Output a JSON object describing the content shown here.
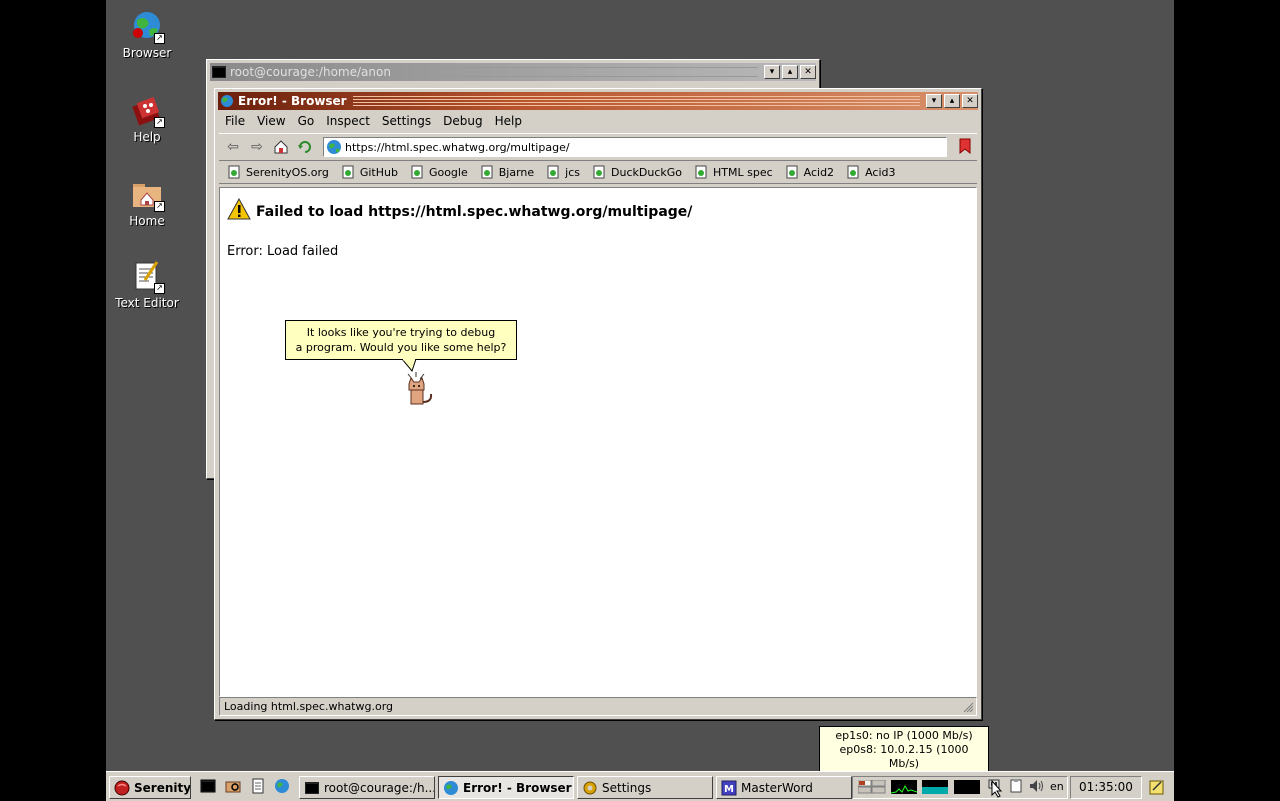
{
  "desktop": {
    "icons": [
      {
        "label": "Browser",
        "icon": "browser-globe-icon"
      },
      {
        "label": "Help",
        "icon": "help-book-icon"
      },
      {
        "label": "Home",
        "icon": "home-folder-icon"
      },
      {
        "label": "Text Editor",
        "icon": "text-editor-icon"
      }
    ]
  },
  "terminal_window": {
    "title": "root@courage:/home/anon"
  },
  "browser_window": {
    "title": "Error! - Browser",
    "menu": [
      "File",
      "View",
      "Go",
      "Inspect",
      "Settings",
      "Debug",
      "Help"
    ],
    "url": "https://html.spec.whatwg.org/multipage/",
    "bookmarks": [
      "SerenityOS.org",
      "GitHub",
      "Google",
      "Bjarne",
      "jcs",
      "DuckDuckGo",
      "HTML spec",
      "Acid2",
      "Acid3"
    ],
    "page": {
      "heading": "Failed to load https://html.spec.whatwg.org/multipage/",
      "error": "Error: Load failed"
    },
    "status": "Loading html.spec.whatwg.org"
  },
  "assistant": {
    "line1": "It looks like you're trying to debug",
    "line2": "a program. Would you like some help?"
  },
  "network_tooltip": {
    "line1": "ep1s0: no IP (1000 Mb/s)",
    "line2": "ep0s8: 10.0.2.15 (1000 Mb/s)"
  },
  "taskbar": {
    "start_label": "Serenity",
    "tasks": [
      {
        "label": "root@courage:/h..."
      },
      {
        "label": "Error! - Browser"
      },
      {
        "label": "Settings"
      },
      {
        "label": "MasterWord"
      }
    ],
    "keymap": "en",
    "clock": "01:35:00"
  },
  "colors": {
    "desktop": "#505050",
    "titlebar_active_start": "#6b1f0c",
    "titlebar_active_end": "#d8916a",
    "titlebar_inactive": "#8a8a8a",
    "assistant_bubble": "#ffffc0"
  }
}
